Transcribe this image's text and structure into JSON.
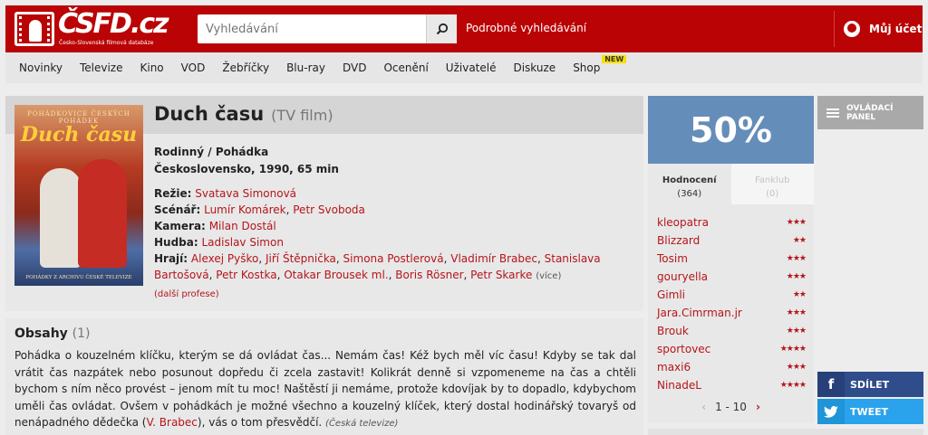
{
  "header": {
    "logo_text": "ČSFD.cz",
    "logo_tagline": "Česko-Slovenská filmová databáze",
    "search_placeholder": "Vyhledávání",
    "advanced_search": "Podrobné vyhledávání",
    "account_label": "Můj účet"
  },
  "nav": {
    "items": [
      "Novinky",
      "Televize",
      "Kino",
      "VOD",
      "Žebříčky",
      "Blu-ray",
      "DVD",
      "Ocenění",
      "Uživatelé",
      "Diskuze",
      "Shop"
    ],
    "new_badge": "NEW"
  },
  "film": {
    "poster_top": "POHÁDKOVICE ČESKÝCH POHÁDEK",
    "poster_title": "Duch času",
    "poster_bottom": "POHÁDKY Z ARCHIVU ČESKÉ TELEVIZE",
    "title": "Duch času",
    "type": "(TV film)",
    "genre": "Rodinný / Pohádka",
    "origin": "Československo, 1990, 65 min",
    "directing_label": "Režie:",
    "directing": [
      "Svatava Simonová"
    ],
    "script_label": "Scénář:",
    "script": [
      "Lumír Komárek",
      "Petr Svoboda"
    ],
    "camera_label": "Kamera:",
    "camera": [
      "Milan Dostál"
    ],
    "music_label": "Hudba:",
    "music": [
      "Ladislav Simon"
    ],
    "cast_label": "Hrají:",
    "cast": [
      "Alexej Pyško",
      "Jiří Štěpnička",
      "Simona Postlerová",
      "Vladimír Brabec",
      "Stanislava Bartošová",
      "Petr Kostka",
      "Otakar Brousek ml.",
      "Boris Rösner",
      "Petr Skarke"
    ],
    "cast_more": "(více)",
    "more_professions": "(další profese)"
  },
  "content": {
    "heading": "Obsahy",
    "count": "(1)",
    "text": "Pohádka o kouzelném klíčku, kterým se dá ovládat čas... Nemám čas! Kéž bych měl víc času! Kdyby se tak dal vrátit čas nazpátek nebo posunout dopředu či zcela zastavit! Kolikrát denně si vzpomeneme na čas a chtěli bychom s ním něco provést – jenom mít tu moc! Naštěstí ji nemáme, protože kdovíjak by to dopadlo, kdybychom uměli čas ovládat. Ovšem v pohádkách je možné všechno a kouzelný klíček, který dostal hodinářský tovaryš od nenápadného dědečka (",
    "link": "V. Brabec",
    "text_end": "), vás o tom přesvědčí.",
    "source": "(Česká televize)"
  },
  "rating": {
    "percent": "50%",
    "tab_ratings": "Hodnocení",
    "tab_ratings_count": "(364)",
    "tab_fanclub": "Fanklub",
    "tab_fanclub_count": "(0)",
    "users": [
      {
        "name": "kleopatra",
        "stars": "★★★",
        "value": 3
      },
      {
        "name": "Blizzard",
        "stars": "★★",
        "value": 2
      },
      {
        "name": "Tosim",
        "stars": "★★★",
        "value": 3
      },
      {
        "name": "gouryella",
        "stars": "★★★",
        "value": 3
      },
      {
        "name": "Gimli",
        "stars": "★★",
        "value": 2
      },
      {
        "name": "Jara.Cimrman.jr",
        "stars": "★★★",
        "value": 3
      },
      {
        "name": "Brouk",
        "stars": "★★★",
        "value": 3
      },
      {
        "name": "sportovec",
        "stars": "★★★★",
        "value": 4
      },
      {
        "name": "maxi6",
        "stars": "★★★",
        "value": 3
      },
      {
        "name": "NinadeL",
        "stars": "★★★★",
        "value": 4
      }
    ],
    "pager": "1 - 10"
  },
  "side": {
    "panel_label_1": "OVLÁDACÍ",
    "panel_label_2": "PANEL",
    "share": "SDÍLET",
    "tweet": "TWEET"
  },
  "colors": {
    "brand_red": "#ba0305",
    "rating_blue": "#658db9",
    "link_red": "#b5151b",
    "facebook": "#2f4c8b",
    "twitter": "#2aa3ec"
  }
}
